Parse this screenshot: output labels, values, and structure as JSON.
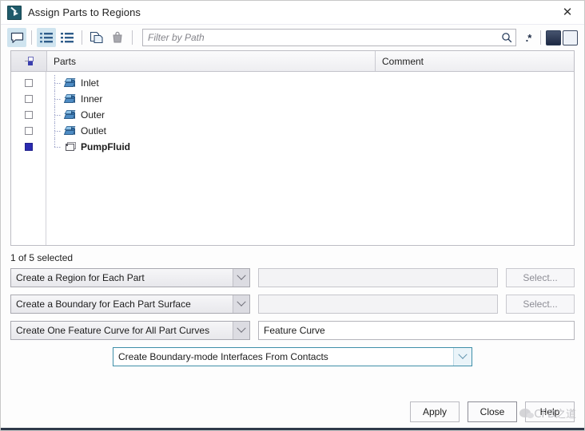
{
  "window": {
    "title": "Assign Parts to Regions",
    "app_icon": "star-ccm-app-icon",
    "close_label": "✕"
  },
  "toolbar": {
    "buttons": [
      {
        "name": "comment-toggle-icon",
        "glyph": "speech-bubble",
        "active": true
      },
      {
        "name": "tree-view-icon",
        "glyph": "tree-list",
        "active": true
      },
      {
        "name": "flat-list-view-icon",
        "glyph": "flat-list",
        "active": false
      },
      {
        "name": "copy-icon",
        "glyph": "copy",
        "active": false
      },
      {
        "name": "paste-icon",
        "glyph": "paste",
        "active": false
      }
    ],
    "filter": {
      "value": "",
      "placeholder": "Filter by Path"
    },
    "search_icon": "search-icon",
    "regex_label": ".*",
    "expand_all_icon": "filled-square-icon",
    "collapse_all_icon": "empty-square-icon"
  },
  "tree": {
    "columns": {
      "select": "",
      "parts": "Parts",
      "comment": "Comment"
    },
    "rows": [
      {
        "label": "Inlet",
        "icon": "part-surface-icon",
        "checked": false,
        "bold": false,
        "comment": ""
      },
      {
        "label": "Inner",
        "icon": "part-surface-icon",
        "checked": false,
        "bold": false,
        "comment": ""
      },
      {
        "label": "Outer",
        "icon": "part-surface-icon",
        "checked": false,
        "bold": false,
        "comment": ""
      },
      {
        "label": "Outlet",
        "icon": "part-surface-icon",
        "checked": false,
        "bold": false,
        "comment": ""
      },
      {
        "label": "PumpFluid",
        "icon": "part-body-icon",
        "checked": true,
        "bold": true,
        "comment": ""
      }
    ]
  },
  "status": {
    "selection_text": "1 of 5 selected"
  },
  "options": [
    {
      "name": "region-mode",
      "combo_value": "Create a Region for Each Part",
      "field_value": "",
      "field_enabled": false,
      "button_label": "Select...",
      "button_enabled": false
    },
    {
      "name": "boundary-mode",
      "combo_value": "Create a Boundary for Each Part Surface",
      "field_value": "",
      "field_enabled": false,
      "button_label": "Select...",
      "button_enabled": false
    },
    {
      "name": "feature-curve-mode",
      "combo_value": "Create One Feature Curve for All Part Curves",
      "field_value": "Feature Curve",
      "field_enabled": true,
      "button_label": "",
      "button_enabled": false
    }
  ],
  "interface_option": {
    "combo_value": "Create Boundary-mode Interfaces From Contacts"
  },
  "footer": {
    "apply_label": "Apply",
    "close_label": "Close",
    "help_label": "Help"
  },
  "watermark": {
    "text": "CFD之道",
    "icon": "wechat-icon"
  },
  "colors": {
    "accent": "#2a2ab0",
    "focus_border": "#3f8fa8",
    "toolbar_active": "#cfe4ef",
    "part_icon": "#4e8cc4"
  }
}
